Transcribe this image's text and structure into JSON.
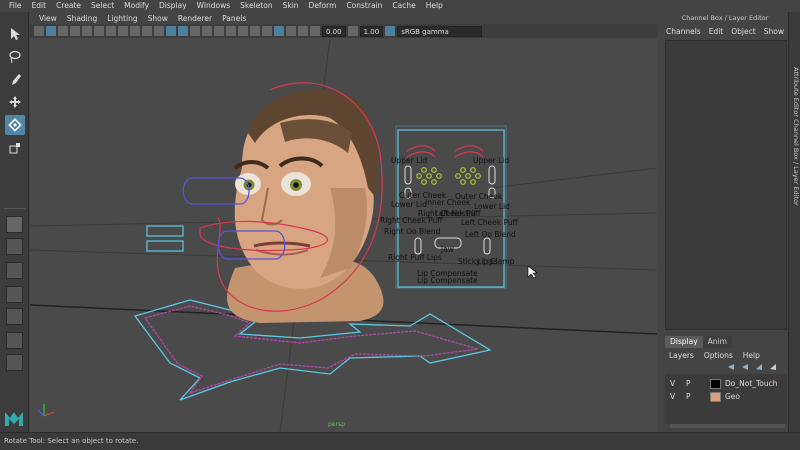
{
  "main_menu": [
    "File",
    "Edit",
    "Create",
    "Select",
    "Modify",
    "Display",
    "Windows",
    "Skeleton",
    "Skin",
    "Deform",
    "Constrain",
    "Cache",
    "Help"
  ],
  "viewport_menu": [
    "View",
    "Shading",
    "Lighting",
    "Show",
    "Renderer",
    "Panels"
  ],
  "viewport_toolbar": {
    "field_1": "0.00",
    "field_2": "1.00",
    "color_space": "sRGB gamma"
  },
  "camera_label": "persp",
  "face_controls": {
    "labels_left": [
      "Upper Lid",
      "Lower Lid",
      "Outer Cheek",
      "Right Cheek Puff",
      "Right Cheek Puff",
      "Right Oo Blend",
      "Right Puff Lips"
    ],
    "labels_right": [
      "Upper Lid",
      "Lower Lid",
      "Outer Cheek",
      "Left Cheek Puff",
      "Left Oo Blend"
    ],
    "labels_center": [
      "Inner Cheek",
      "Left Nostril",
      "Jaw",
      "Sticky Lips",
      "Lip Clamp",
      "Lip Compensate",
      "Lip Compensate"
    ]
  },
  "channel_box": {
    "title": "Channel Box / Layer Editor",
    "menu": [
      "Channels",
      "Edit",
      "Object",
      "Show"
    ]
  },
  "side_strip_label": "Attribute Editor   Channel Box / Layer Editor",
  "layer_editor": {
    "tabs": [
      "Display",
      "Anim"
    ],
    "menu": [
      "Layers",
      "Options",
      "Help"
    ],
    "layers": [
      {
        "v": "V",
        "p": "P",
        "name": "Do_Not_Touch",
        "color": "#000000"
      },
      {
        "v": "V",
        "p": "P",
        "name": "Geo",
        "color": "#d9a27a"
      }
    ]
  },
  "status_bar": "Rotate Tool: Select an object to rotate.",
  "colors": {
    "accent": "#5285a6",
    "curve_cyan": "#5cc8e6",
    "curve_red": "#d9374f",
    "curve_blue": "#5855d4",
    "curve_magenta": "#b04aa8",
    "viewport_bg": "#4a4a4a"
  }
}
